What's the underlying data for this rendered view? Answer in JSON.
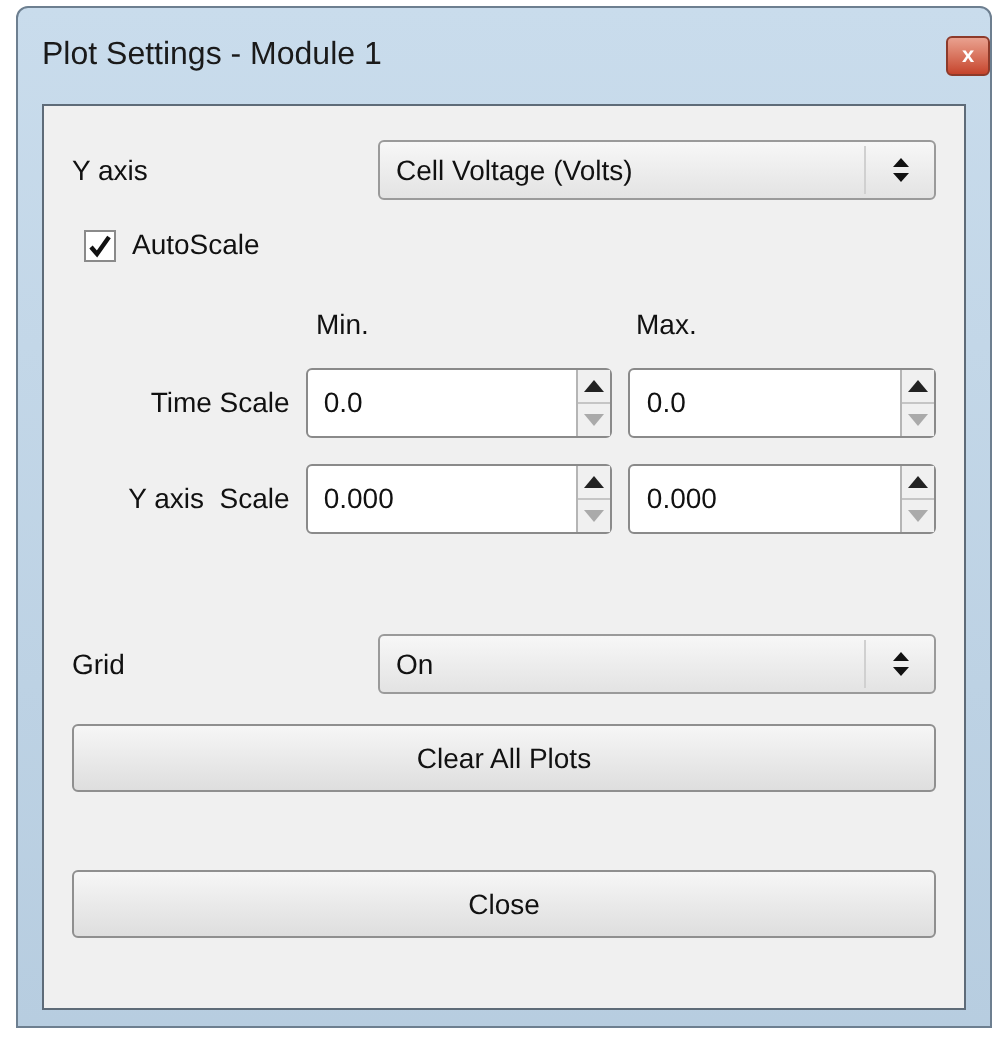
{
  "window": {
    "title": "Plot Settings - Module 1",
    "close_glyph": "x"
  },
  "y_axis": {
    "label": "Y axis",
    "value": "Cell Voltage (Volts)"
  },
  "autoscale": {
    "label": "AutoScale",
    "checked": true
  },
  "scale_headers": [
    "Min.",
    "Max."
  ],
  "scale_rows": [
    {
      "label": "Time Scale",
      "min": "0.0",
      "max": "0.0"
    },
    {
      "label": "Y axis  Scale",
      "min": "0.000",
      "max": "0.000"
    }
  ],
  "grid": {
    "label": "Grid",
    "value": "On"
  },
  "buttons": [
    "Clear All Plots",
    "Close"
  ]
}
